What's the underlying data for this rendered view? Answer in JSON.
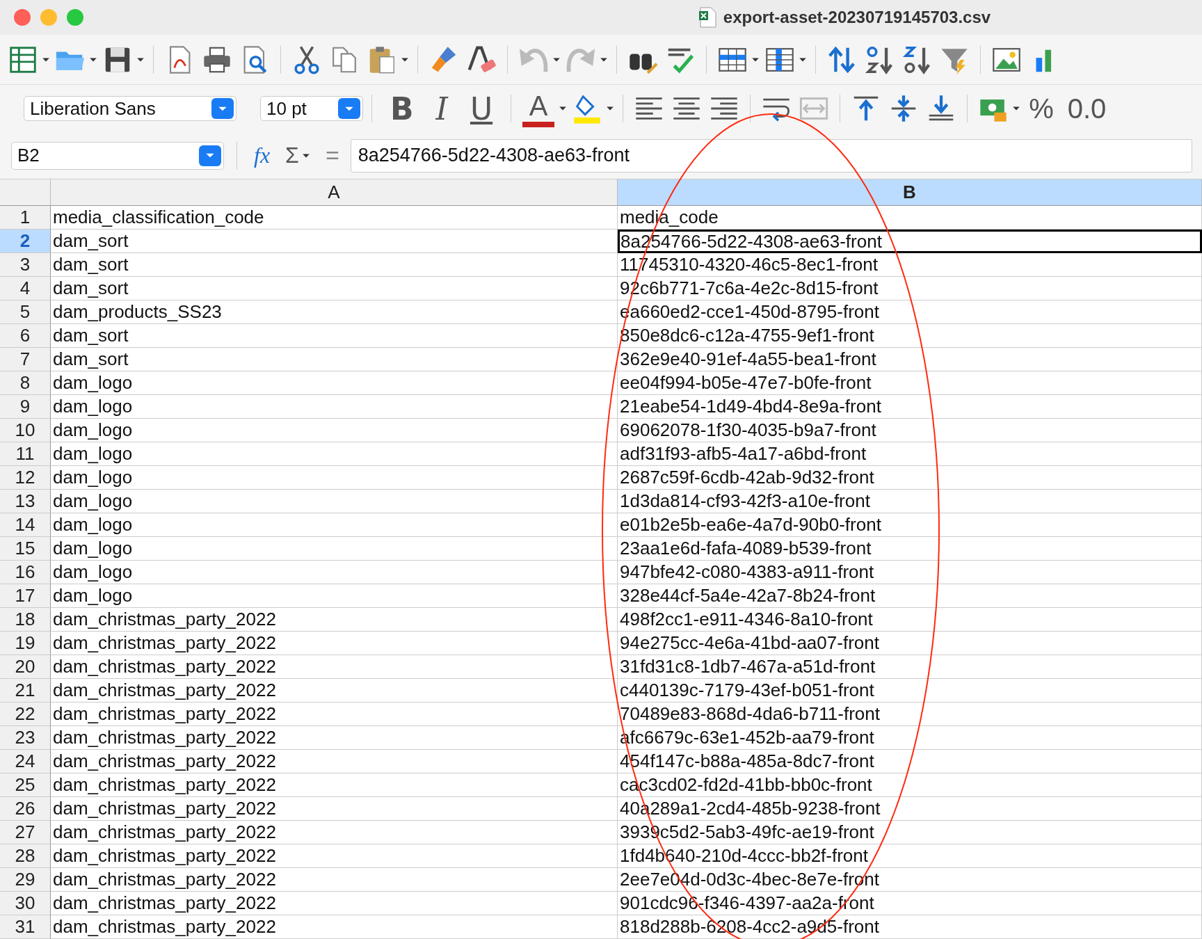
{
  "window": {
    "title": "export-asset-20230719145703.csv"
  },
  "formatting": {
    "font": "Liberation Sans",
    "size": "10 pt",
    "style_buttons": [
      {
        "label": "B",
        "kind": "bold"
      },
      {
        "label": "I",
        "kind": "italic"
      },
      {
        "label": "U",
        "kind": "underline"
      }
    ],
    "font_color_label": "A",
    "percent_label": "%",
    "decimal_label": "0.0"
  },
  "formula_bar": {
    "cell_reference": "B2",
    "function_wizard": "fx",
    "sum": "Σ",
    "equals": "=",
    "value": "8a254766-5d22-4308-ae63-front"
  },
  "sheet": {
    "columns": [
      {
        "label": "A",
        "selected": false
      },
      {
        "label": "B",
        "selected": true
      }
    ],
    "rows": [
      {
        "number": "1",
        "selected": false,
        "cells": [
          "media_classification_code",
          "media_code"
        ]
      },
      {
        "number": "2",
        "selected": true,
        "cells": [
          "dam_sort",
          "8a254766-5d22-4308-ae63-front"
        ]
      },
      {
        "number": "3",
        "selected": false,
        "cells": [
          "dam_sort",
          "11745310-4320-46c5-8ec1-front"
        ]
      },
      {
        "number": "4",
        "selected": false,
        "cells": [
          "dam_sort",
          "92c6b771-7c6a-4e2c-8d15-front"
        ]
      },
      {
        "number": "5",
        "selected": false,
        "cells": [
          "dam_products_SS23",
          "ea660ed2-cce1-450d-8795-front"
        ]
      },
      {
        "number": "6",
        "selected": false,
        "cells": [
          "dam_sort",
          "850e8dc6-c12a-4755-9ef1-front"
        ]
      },
      {
        "number": "7",
        "selected": false,
        "cells": [
          "dam_sort",
          "362e9e40-91ef-4a55-bea1-front"
        ]
      },
      {
        "number": "8",
        "selected": false,
        "cells": [
          "dam_logo",
          "ee04f994-b05e-47e7-b0fe-front"
        ]
      },
      {
        "number": "9",
        "selected": false,
        "cells": [
          "dam_logo",
          "21eabe54-1d49-4bd4-8e9a-front"
        ]
      },
      {
        "number": "10",
        "selected": false,
        "cells": [
          "dam_logo",
          "69062078-1f30-4035-b9a7-front"
        ]
      },
      {
        "number": "11",
        "selected": false,
        "cells": [
          "dam_logo",
          "adf31f93-afb5-4a17-a6bd-front"
        ]
      },
      {
        "number": "12",
        "selected": false,
        "cells": [
          "dam_logo",
          "2687c59f-6cdb-42ab-9d32-front"
        ]
      },
      {
        "number": "13",
        "selected": false,
        "cells": [
          "dam_logo",
          "1d3da814-cf93-42f3-a10e-front"
        ]
      },
      {
        "number": "14",
        "selected": false,
        "cells": [
          "dam_logo",
          "e01b2e5b-ea6e-4a7d-90b0-front"
        ]
      },
      {
        "number": "15",
        "selected": false,
        "cells": [
          "dam_logo",
          "23aa1e6d-fafa-4089-b539-front"
        ]
      },
      {
        "number": "16",
        "selected": false,
        "cells": [
          "dam_logo",
          "947bfe42-c080-4383-a911-front"
        ]
      },
      {
        "number": "17",
        "selected": false,
        "cells": [
          "dam_logo",
          "328e44cf-5a4e-42a7-8b24-front"
        ]
      },
      {
        "number": "18",
        "selected": false,
        "cells": [
          "dam_christmas_party_2022",
          "498f2cc1-e911-4346-8a10-front"
        ]
      },
      {
        "number": "19",
        "selected": false,
        "cells": [
          "dam_christmas_party_2022",
          "94e275cc-4e6a-41bd-aa07-front"
        ]
      },
      {
        "number": "20",
        "selected": false,
        "cells": [
          "dam_christmas_party_2022",
          "31fd31c8-1db7-467a-a51d-front"
        ]
      },
      {
        "number": "21",
        "selected": false,
        "cells": [
          "dam_christmas_party_2022",
          "c440139c-7179-43ef-b051-front"
        ]
      },
      {
        "number": "22",
        "selected": false,
        "cells": [
          "dam_christmas_party_2022",
          "70489e83-868d-4da6-b711-front"
        ]
      },
      {
        "number": "23",
        "selected": false,
        "cells": [
          "dam_christmas_party_2022",
          "afc6679c-63e1-452b-aa79-front"
        ]
      },
      {
        "number": "24",
        "selected": false,
        "cells": [
          "dam_christmas_party_2022",
          "454f147c-b88a-485a-8dc7-front"
        ]
      },
      {
        "number": "25",
        "selected": false,
        "cells": [
          "dam_christmas_party_2022",
          "cac3cd02-fd2d-41bb-bb0c-front"
        ]
      },
      {
        "number": "26",
        "selected": false,
        "cells": [
          "dam_christmas_party_2022",
          "40a289a1-2cd4-485b-9238-front"
        ]
      },
      {
        "number": "27",
        "selected": false,
        "cells": [
          "dam_christmas_party_2022",
          "3939c5d2-5ab3-49fc-ae19-front"
        ]
      },
      {
        "number": "28",
        "selected": false,
        "cells": [
          "dam_christmas_party_2022",
          "1fd4b640-210d-4ccc-bb2f-front"
        ]
      },
      {
        "number": "29",
        "selected": false,
        "cells": [
          "dam_christmas_party_2022",
          "2ee7e04d-0d3c-4bec-8e7e-front"
        ]
      },
      {
        "number": "30",
        "selected": false,
        "cells": [
          "dam_christmas_party_2022",
          "901cdc96-f346-4397-aa2a-front"
        ]
      },
      {
        "number": "31",
        "selected": false,
        "cells": [
          "dam_christmas_party_2022",
          "818d288b-6208-4cc2-a9d5-front"
        ]
      }
    ]
  }
}
